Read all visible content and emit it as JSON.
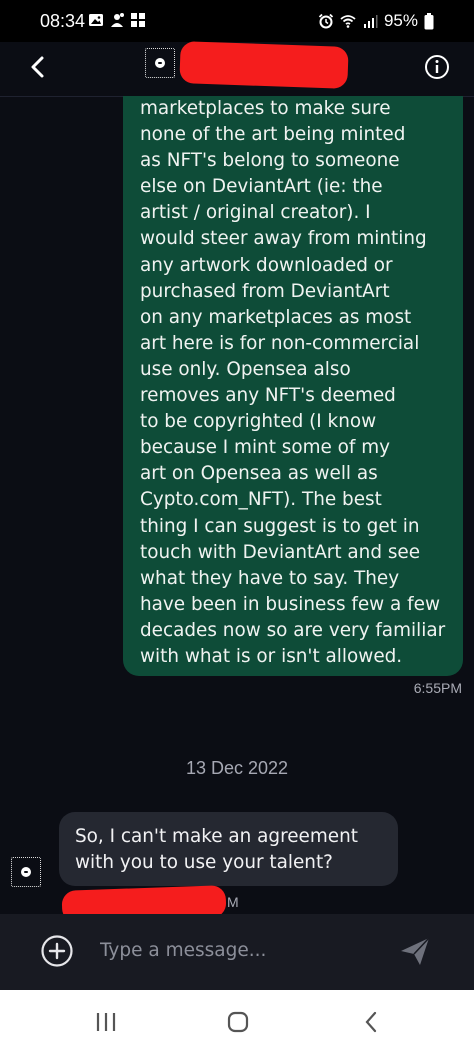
{
  "status_bar": {
    "time": "08:34",
    "battery": "95%",
    "left_icons": [
      "gallery-icon",
      "person-alert-icon",
      "windows-icon"
    ],
    "right_icons": [
      "alarm-icon",
      "wifi-icon",
      "signal-icon",
      "battery-icon"
    ]
  },
  "header": {
    "back_icon": "back-arrow-icon",
    "info_icon": "info-icon"
  },
  "messages": {
    "outgoing": {
      "text": "marketplaces to make sure\nnone of the art being minted\nas NFT's belong to someone\nelse on DeviantArt (ie: the\nartist / original creator). I\nwould steer away from minting\nany artwork downloaded or\npurchased from DeviantArt\non any marketplaces as most\nart here is for non-commercial\nuse only. Opensea also\nremoves any NFT's deemed\nto be copyrighted (I know\nbecause I mint some of my\nart on Opensea as well as\nCypto.com_NFT). The best\nthing I can suggest is to get in\ntouch with DeviantArt and see\nwhat they have to say. They\nhave been in business few a few\ndecades now so are very familiar\nwith what is or isn't allowed.",
      "time": "6:55PM"
    },
    "date_separator": "13 Dec 2022",
    "incoming": {
      "text": "So, I can't make an agreement\nwith you to use your talent?"
    }
  },
  "composer": {
    "placeholder": "Type a message...",
    "add_icon": "add-circle-icon",
    "send_icon": "send-icon"
  },
  "nav": {
    "icons": [
      "recent-apps-icon",
      "home-icon",
      "back-icon"
    ]
  },
  "colors": {
    "background": "#0b0d14",
    "outgoing_bubble": "#0e4c38",
    "incoming_bubble": "#252831",
    "redaction": "#f51d1d"
  }
}
